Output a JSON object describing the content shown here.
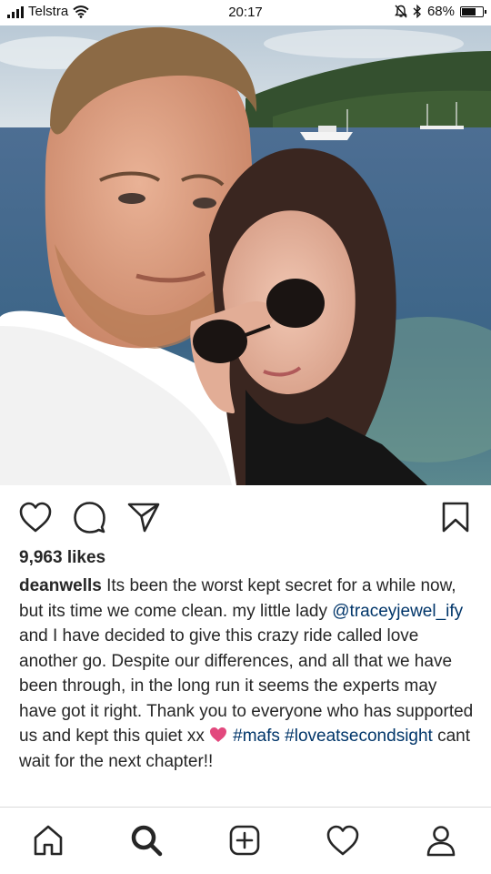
{
  "status_bar": {
    "carrier": "Telstra",
    "time": "20:17",
    "battery": "68%",
    "battery_level": 0.68,
    "icons": [
      "signal-icon",
      "wifi-icon",
      "alarm-off-icon",
      "bluetooth-icon",
      "battery-icon"
    ]
  },
  "post": {
    "image_subject": "photo",
    "actions": [
      "like-icon",
      "comment-icon",
      "share-icon",
      "save-icon"
    ],
    "likes": "9,963 likes",
    "caption": {
      "username": "deanwells",
      "part1": " Its been the worst kept secret for a while now, but its time we come clean. my little lady ",
      "mention": "@traceyjewel_ify",
      "part2": " and I have decided to give this crazy ride called love another go. Despite our differences, and all that we have been through, in the long run it seems the experts may have got it right. Thank you to everyone who has supported us and kept this quiet xx ",
      "hashtag1": "#mafs",
      "hashtag2": "#loveatsecondsight",
      "part3": " cant wait for the next chapter!!"
    }
  },
  "colors": {
    "text": "#262626",
    "link": "#003569",
    "emoji_heart": "#e2487d",
    "divider": "#dbdbdb"
  },
  "bottom_nav": [
    "home-icon",
    "search-icon",
    "new-post-icon",
    "activity-icon",
    "profile-icon"
  ]
}
